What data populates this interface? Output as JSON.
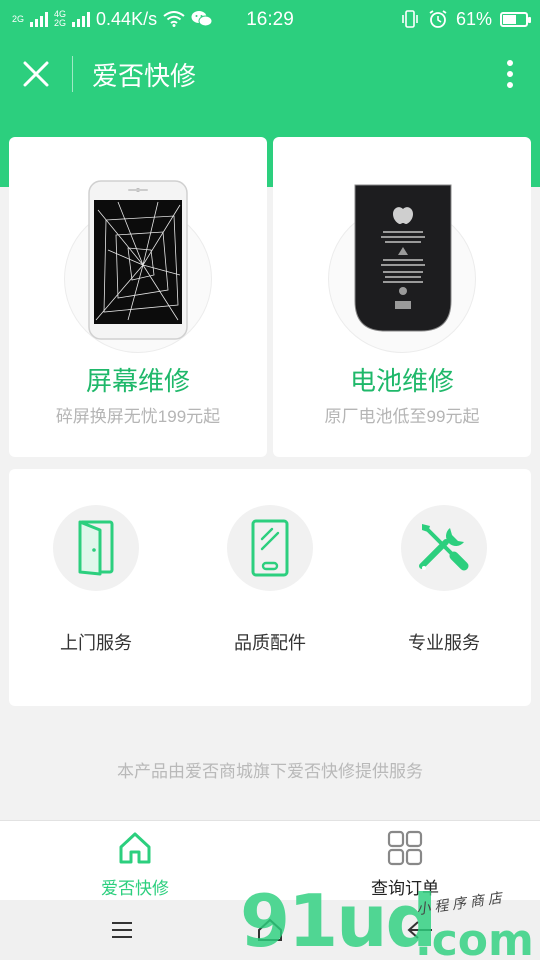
{
  "status_bar": {
    "network_top": "4G",
    "network_bottom": "2G",
    "network_left": "2G",
    "speed": "0.44K/s",
    "time": "16:29",
    "battery_percent": "61%",
    "battery_level": 0.61
  },
  "header": {
    "title": "爱否快修"
  },
  "repair_cards": [
    {
      "title": "屏幕维修",
      "subtitle": "碎屏换屏无忧199元起"
    },
    {
      "title": "电池维修",
      "subtitle": "原厂电池低至99元起"
    }
  ],
  "services": [
    {
      "label": "上门服务",
      "icon": "door-icon"
    },
    {
      "label": "品质配件",
      "icon": "phone-part-icon"
    },
    {
      "label": "专业服务",
      "icon": "tools-icon"
    }
  ],
  "footnote": "本产品由爱否商城旗下爱否快修提供服务",
  "tabbar": [
    {
      "label": "爱否快修",
      "icon": "home-icon",
      "active": true
    },
    {
      "label": "查询订单",
      "icon": "grid-icon",
      "active": false
    }
  ],
  "watermark": {
    "main": "91ud",
    "com": ".com",
    "tagline": "小程序商店"
  },
  "colors": {
    "brand": "#2ccf7e",
    "accent_text": "#1fb86a",
    "background": "#f2f2f2"
  }
}
